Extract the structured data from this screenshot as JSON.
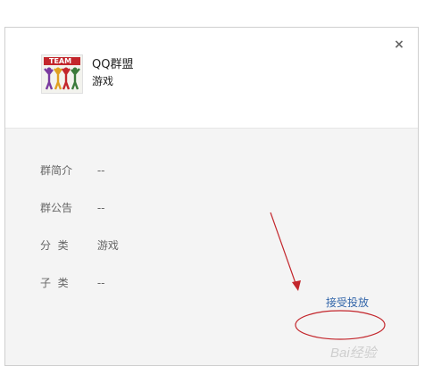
{
  "header": {
    "group_name": "QQ群盟",
    "group_type": "游戏",
    "avatar_text": "TEAM"
  },
  "close": {
    "symbol": "×"
  },
  "details": [
    {
      "label": "群简介",
      "value": "--"
    },
    {
      "label": "群公告",
      "value": "--"
    },
    {
      "label": "分  类",
      "value": "游戏"
    },
    {
      "label": "子  类",
      "value": "--"
    }
  ],
  "actions": {
    "accept_label": "接受投放"
  },
  "watermark": {
    "text": "Bai经验"
  },
  "colors": {
    "link": "#3366aa",
    "annotation": "#c3262c",
    "panel_bg": "#f4f4f4"
  }
}
